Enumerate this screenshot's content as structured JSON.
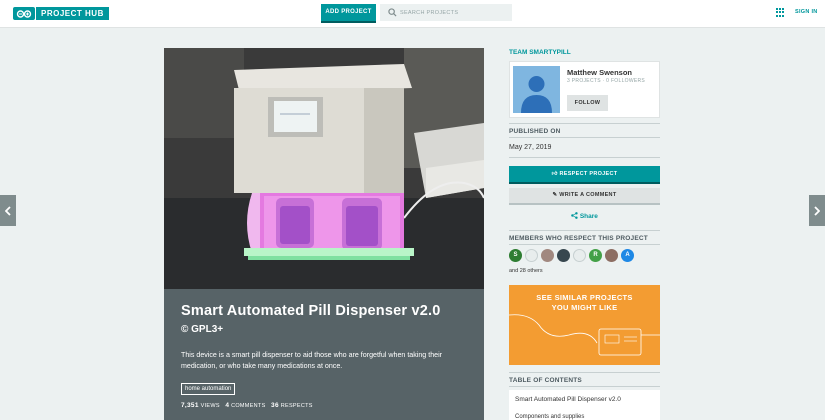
{
  "header": {
    "logo_text": "PROJECT HUB",
    "add_project_label": "ADD PROJECT",
    "search_placeholder": "SEARCH PROJECTS",
    "signin_label": "SIGN IN"
  },
  "project": {
    "title": "Smart Automated Pill Dispenser v2.0",
    "license": "© GPL3+",
    "description": "This device is a smart pill dispenser to aid those who are forgetful when taking their medication, or who take many medications at once.",
    "tag": "home automation",
    "stats": {
      "views_count": "7,351",
      "views_label": "VIEWS",
      "comments_count": "4",
      "comments_label": "COMMENTS",
      "respects_count": "36",
      "respects_label": "RESPECTS"
    }
  },
  "sidebar": {
    "team_label": "TEAM SMARTYPILL",
    "member": {
      "name": "Matthew Swenson",
      "stats": "3 PROJECTS · 0 FOLLOWERS",
      "follow_label": "FOLLOW"
    },
    "published_label": "PUBLISHED ON",
    "published_date": "May 27, 2019",
    "respect_label": "RESPECT PROJECT",
    "comment_label": "WRITE A COMMENT",
    "share_label": "Share",
    "members_label": "MEMBERS WHO RESPECT THIS PROJECT",
    "respecters": [
      {
        "initial": "S",
        "color": "#2e7d32"
      },
      {
        "initial": "",
        "color": "#e8eded"
      },
      {
        "initial": "",
        "color": "#a1887f"
      },
      {
        "initial": "",
        "color": "#37474f"
      },
      {
        "initial": "",
        "color": "#e8eded"
      },
      {
        "initial": "R",
        "color": "#43a047"
      },
      {
        "initial": "",
        "color": "#8d6e63"
      },
      {
        "initial": "A",
        "color": "#1e88e5"
      }
    ],
    "others_label": "and 28 others",
    "similar_label_line1": "SEE SIMILAR PROJECTS",
    "similar_label_line2": "YOU MIGHT LIKE",
    "toc_label": "TABLE OF CONTENTS",
    "toc_items": [
      "Smart Automated Pill Dispenser v2.0",
      "Components and supplies"
    ]
  },
  "colors": {
    "accent": "#00979c",
    "hero_body": "#576367",
    "similar_bg": "#f39c32"
  }
}
